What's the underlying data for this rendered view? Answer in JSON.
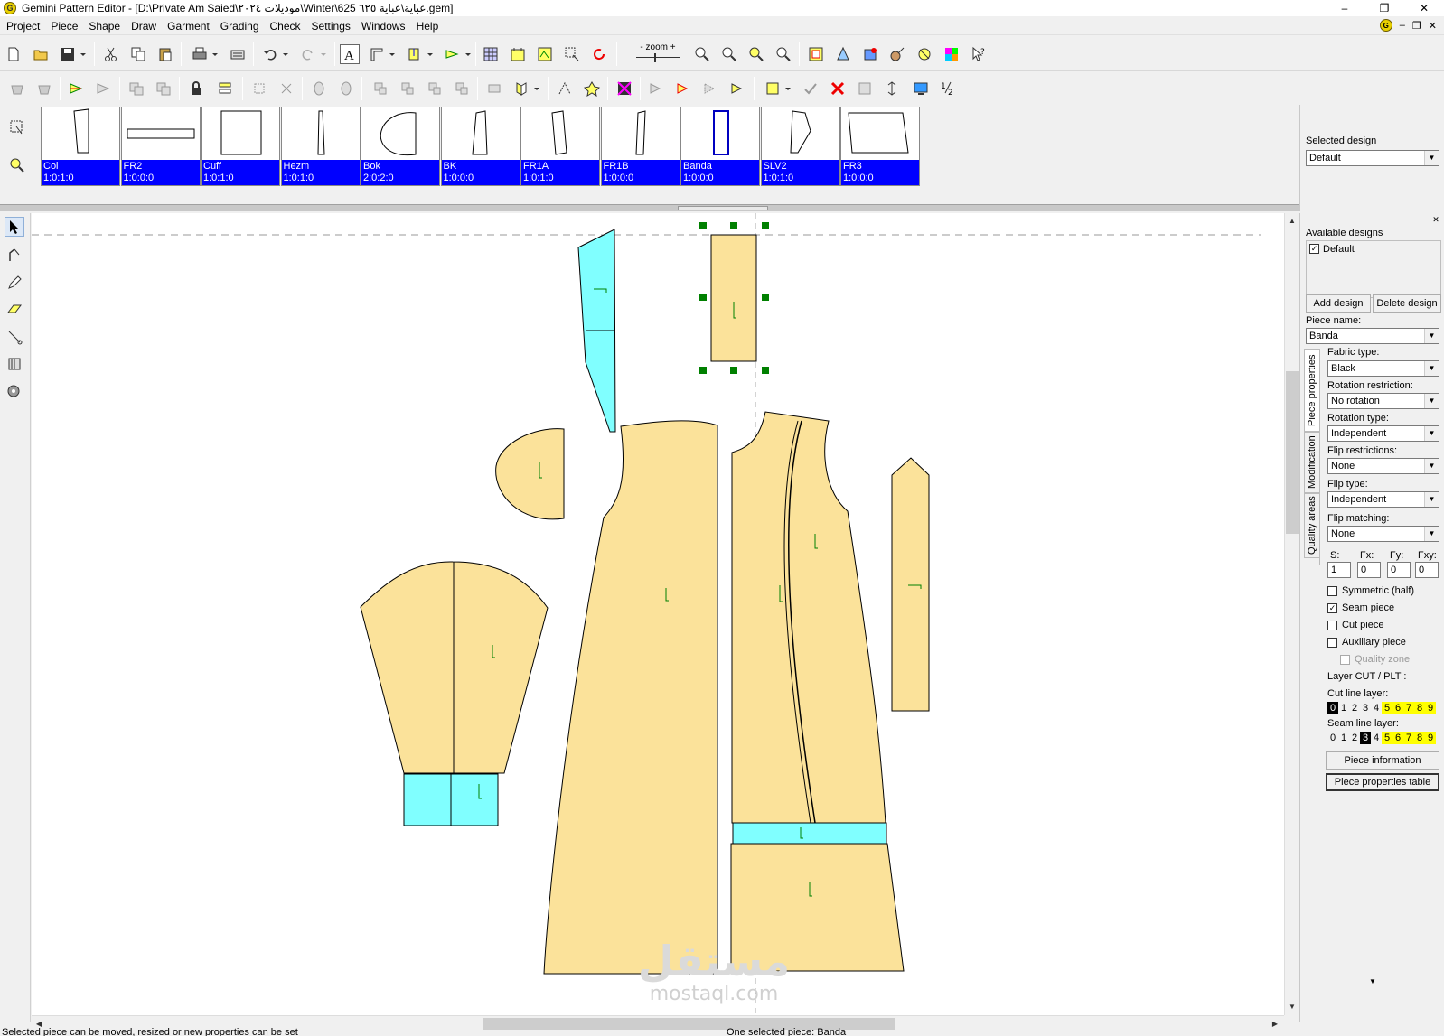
{
  "window": {
    "title": "Gemini Pattern Editor - [D:\\Private Am Saied\\موديلات ٢٠٢٤\\Winter\\625 عباية\\عباية ٦٢٥.gem]",
    "min": "–",
    "max": "❐",
    "close": "✕"
  },
  "menu": [
    "Project",
    "Piece",
    "Shape",
    "Draw",
    "Garment",
    "Grading",
    "Check",
    "Settings",
    "Windows",
    "Help"
  ],
  "zoom_label": "zoom",
  "zoom_minus": "-",
  "zoom_plus": "+",
  "pieces": [
    {
      "name": "Col",
      "code": "1:0:1:0"
    },
    {
      "name": "FR2",
      "code": "1:0:0:0"
    },
    {
      "name": "Cuff",
      "code": "1:0:1:0"
    },
    {
      "name": "Hezm",
      "code": "1:0:1:0"
    },
    {
      "name": "Bok",
      "code": "2:0:2:0"
    },
    {
      "name": "BK",
      "code": "1:0:0:0"
    },
    {
      "name": "FR1A",
      "code": "1:0:1:0"
    },
    {
      "name": "FR1B",
      "code": "1:0:0:0"
    },
    {
      "name": "Banda",
      "code": "1:0:0:0"
    },
    {
      "name": "SLV2",
      "code": "1:0:1:0"
    },
    {
      "name": "FR3",
      "code": "1:0:0:0"
    }
  ],
  "design": {
    "selected_label": "Selected design",
    "selected_value": "Default"
  },
  "panel": {
    "available_label": "Available designs",
    "available_item": "Default",
    "add_button": "Add design",
    "delete_button": "Delete design",
    "piece_name_label": "Piece name:",
    "piece_name": "Banda",
    "tabs": [
      "Piece properties",
      "Modification",
      "Quality areas"
    ],
    "fabric_type_label": "Fabric type:",
    "fabric_type": "Black",
    "rotation_restriction_label": "Rotation restriction:",
    "rotation_restriction": "No rotation",
    "rotation_type_label": "Rotation type:",
    "rotation_type": "Independent",
    "flip_restrictions_label": "Flip restrictions:",
    "flip_restrictions": "None",
    "flip_type_label": "Flip type:",
    "flip_type": "Independent",
    "flip_matching_label": "Flip matching:",
    "flip_matching": "None",
    "s_label": "S:",
    "s_value": "1",
    "fx_label": "Fx:",
    "fx_value": "0",
    "fy_label": "Fy:",
    "fy_value": "0",
    "fxy_label": "Fxy:",
    "fxy_value": "0",
    "symmetric_label": "Symmetric (half)",
    "seam_piece_label": "Seam piece",
    "cut_piece_label": "Cut piece",
    "auxiliary_label": "Auxiliary piece",
    "quality_zone_label": "Quality zone",
    "layer_label": "Layer CUT / PLT :",
    "cut_line_label": "Cut line layer:",
    "seam_line_label": "Seam line layer:",
    "layers": [
      "0",
      "1",
      "2",
      "3",
      "4",
      "5",
      "6",
      "7",
      "8",
      "9"
    ],
    "piece_info_button": "Piece information",
    "piece_table_button": "Piece properties table"
  },
  "status": {
    "left": "Selected piece can be moved, resized or new properties can be set",
    "right": "One selected piece: Banda"
  },
  "watermark": {
    "ar": "مستقل",
    "en": "mostaql.com"
  },
  "colors": {
    "piece_fill": "#fbe29a",
    "cyan_fill": "#80ffff",
    "label_blue": "#0000ff",
    "handle_green": "#008000"
  }
}
